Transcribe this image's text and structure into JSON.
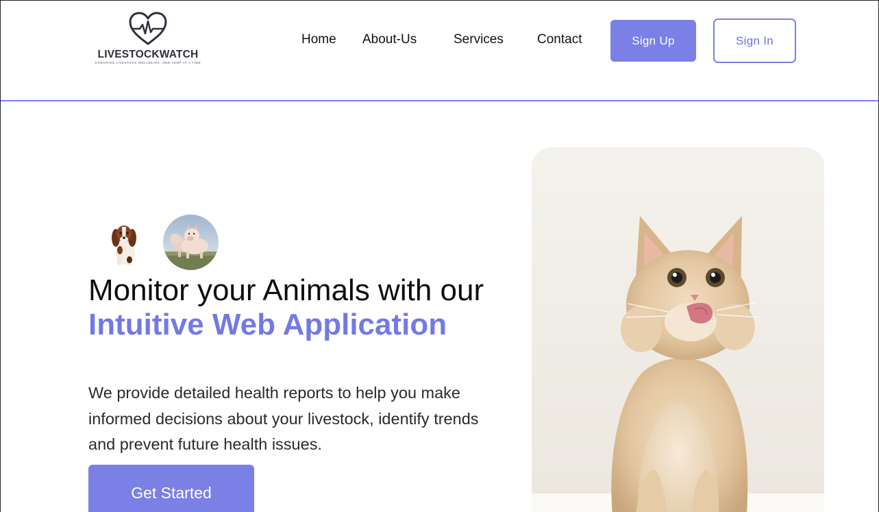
{
  "header": {
    "logo": {
      "brand": "LIVESTOCKWATCH",
      "tagline": "ENSURING LIVESTOCK WELLBEING, ONE TEMP AT A TIME"
    },
    "nav": [
      {
        "label": "Home"
      },
      {
        "label": "About-Us"
      },
      {
        "label": "Services"
      },
      {
        "label": "Contact"
      }
    ],
    "sign_up_label": "Sign Up",
    "sign_in_label": "Sign In"
  },
  "hero": {
    "headline_part1": "Monitor your Animals with our ",
    "headline_accent": "Intuitive Web Application",
    "description": "We provide detailed health reports to help you make informed decisions about your livestock, identify trends and prevent future health issues.",
    "cta_label": "Get Started",
    "images": {
      "avatar_1": "puppy photo",
      "avatar_2": "piglets photo",
      "main": "kitten photo"
    }
  },
  "colors": {
    "accent": "#7b80e6",
    "accent_text": "#7379e4",
    "divider": "#7b80e6"
  }
}
